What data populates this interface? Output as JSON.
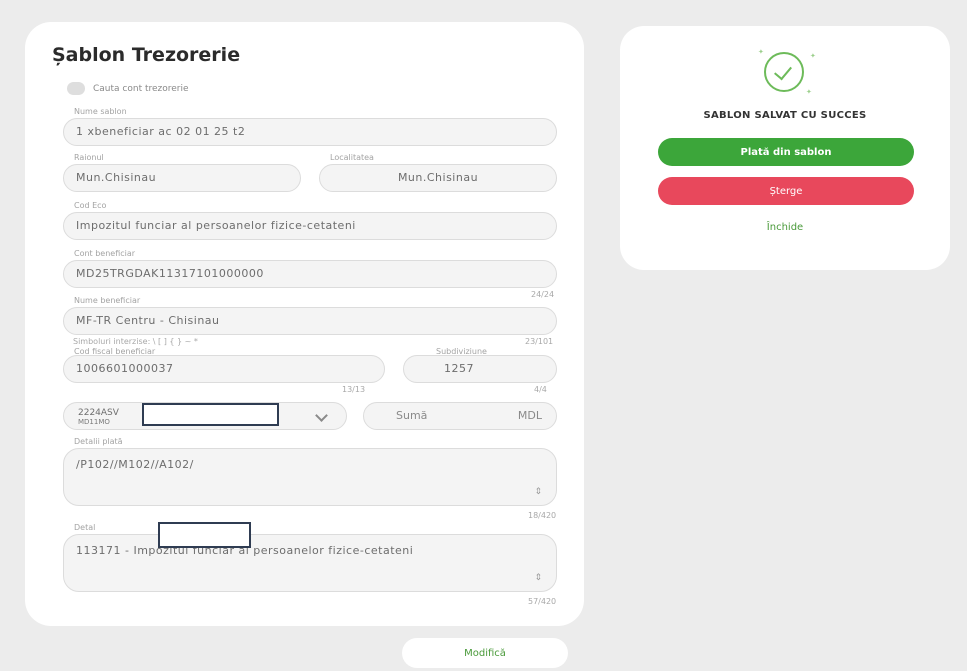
{
  "form": {
    "title": "Șablon Trezorerie",
    "search_treasury_label": "Cauta cont trezorerie",
    "template_name": {
      "label": "Nume sablon",
      "value": "1 xbeneficiar ac 02 01 25 t2"
    },
    "district": {
      "label": "Raionul",
      "value": "Mun.Chisinau"
    },
    "locality": {
      "label": "Localitatea",
      "value": "Mun.Chisinau"
    },
    "eco_code": {
      "label": "Cod Eco",
      "value": "Impozitul funciar al persoanelor fizice-cetateni"
    },
    "beneficiary_account": {
      "label": "Cont beneficiar",
      "value": "MD25TRGDAK11317101000000",
      "counter": "24/24"
    },
    "beneficiary_name": {
      "label": "Nume beneficiar",
      "value": "MF-TR Centru - Chisinau",
      "counter": "23/101"
    },
    "forbidden_symbols": "Simboluri interzise: \\ [ ] { } ~ * ",
    "fiscal_code": {
      "label": "Cod fiscal beneficiar",
      "value": "1006601000037",
      "counter": "13/13"
    },
    "subdivision": {
      "label": "Subdiviziune",
      "value": "1257",
      "counter": "4/4"
    },
    "source_account": {
      "line1": "2224ASV",
      "line2": "MD11MO"
    },
    "amount": {
      "label": "Sumă",
      "currency": "MDL"
    },
    "payment_details": {
      "label": "Detalii plată",
      "value": "/P102//M102//A102/",
      "counter": "18/420"
    },
    "details2": {
      "label": "Detal",
      "value": "113171 - Impozitul funciar al persoanelor fizice-cetateni",
      "counter": "57/420"
    },
    "modify_label": "Modifică"
  },
  "success": {
    "title": "SABLON SALVAT CU SUCCES",
    "pay_label": "Plată din sablon",
    "delete_label": "Șterge",
    "close_label": "Închide"
  },
  "colors": {
    "green": "#3ca63a",
    "red": "#e8485c",
    "redaction_border": "#2f3c52"
  }
}
